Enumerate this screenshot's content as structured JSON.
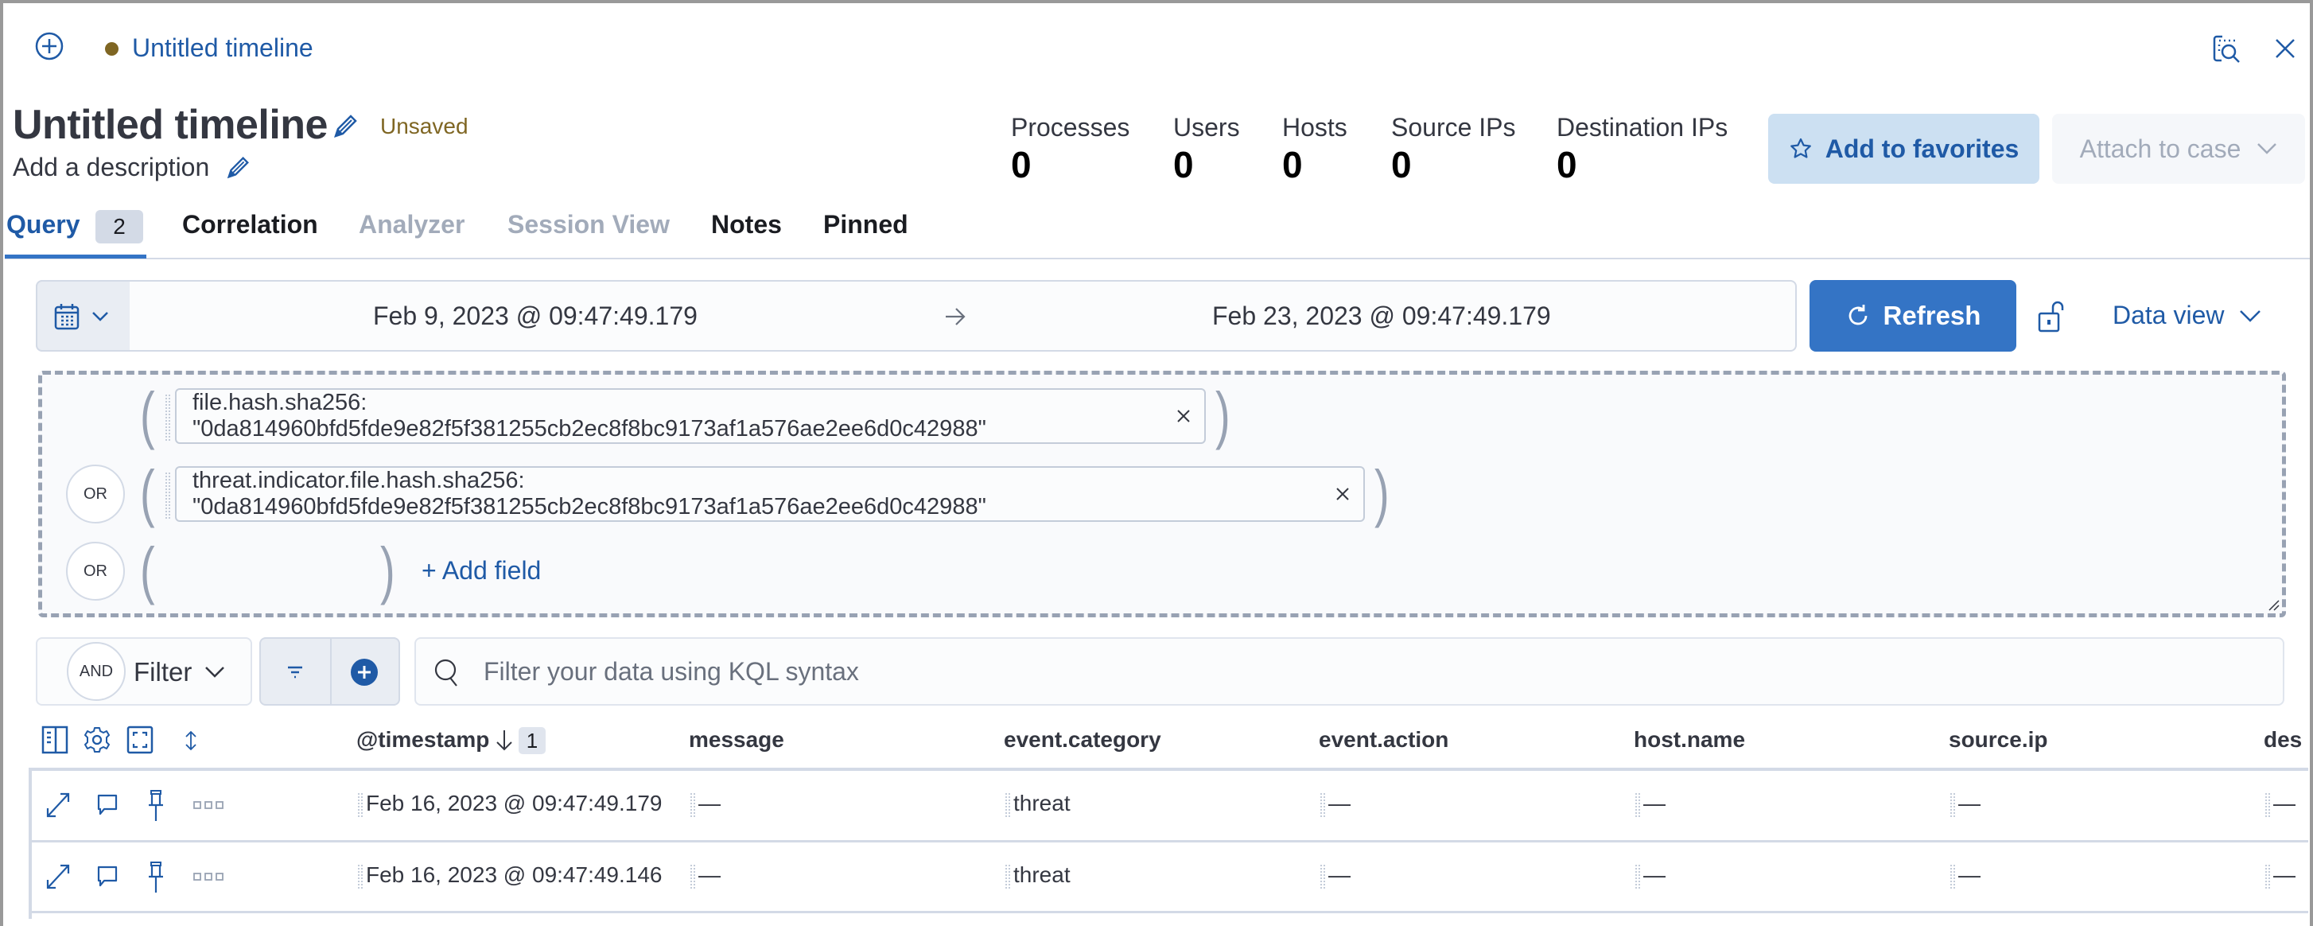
{
  "window": {
    "flyout_title": "Untitled timeline",
    "status_dot_color": "#7f6623"
  },
  "header": {
    "title": "Untitled timeline",
    "status": "Unsaved",
    "description": "Add a description"
  },
  "stats": [
    {
      "label": "Processes",
      "value": "0"
    },
    {
      "label": "Users",
      "value": "0"
    },
    {
      "label": "Hosts",
      "value": "0"
    },
    {
      "label": "Source IPs",
      "value": "0"
    },
    {
      "label": "Destination IPs",
      "value": "0"
    }
  ],
  "actions": {
    "favorites": "Add to favorites",
    "attach": "Attach to case"
  },
  "tabs": [
    {
      "label": "Query",
      "badge": "2",
      "state": "active"
    },
    {
      "label": "Correlation",
      "state": "enabled"
    },
    {
      "label": "Analyzer",
      "state": "disabled"
    },
    {
      "label": "Session View",
      "state": "disabled"
    },
    {
      "label": "Notes",
      "state": "enabled"
    },
    {
      "label": "Pinned",
      "state": "enabled"
    }
  ],
  "date_range": {
    "start": "Feb 9, 2023 @ 09:47:49.179",
    "end": "Feb 23, 2023 @ 09:47:49.179",
    "refresh_label": "Refresh",
    "data_view_label": "Data view"
  },
  "query_builder": {
    "groups": [
      {
        "operator": "",
        "field": "file.hash.sha256: \"0da814960bfd5fde9e82f5f381255cb2ec8f8bc9173af1a576ae2ee6d0c42988\""
      },
      {
        "operator": "OR",
        "field": "threat.indicator.file.hash.sha256: \"0da814960bfd5fde9e82f5f381255cb2ec8f8bc9173af1a576ae2ee6d0c42988\""
      },
      {
        "operator": "OR",
        "field": ""
      }
    ],
    "add_field_label": "+ Add field"
  },
  "filter_bar": {
    "operator": "AND",
    "filter_label": "Filter",
    "kql_placeholder": "Filter your data using KQL syntax"
  },
  "table": {
    "columns": [
      "@timestamp",
      "message",
      "event.category",
      "event.action",
      "host.name",
      "source.ip",
      "des"
    ],
    "sort_count": "1",
    "rows": [
      [
        "Feb 16, 2023 @ 09:47:49.179",
        "—",
        "threat",
        "—",
        "—",
        "—",
        "—"
      ],
      [
        "Feb 16, 2023 @ 09:47:49.146",
        "—",
        "threat",
        "—",
        "—",
        "—",
        "—"
      ]
    ]
  }
}
